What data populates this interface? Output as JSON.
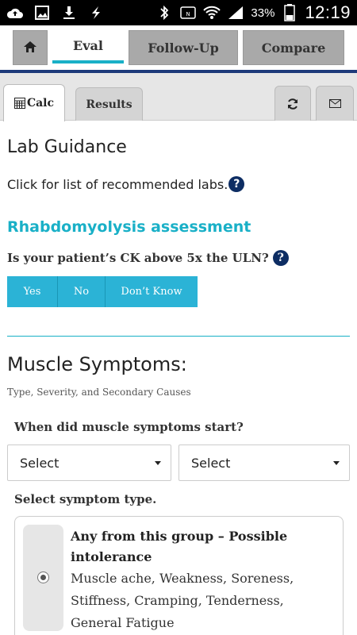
{
  "status_bar": {
    "battery": "33%",
    "time": "12:19",
    "left_icons": [
      "cloud-upload-icon",
      "image-icon",
      "download-icon",
      "lightning-icon"
    ],
    "right_icons": [
      "bluetooth-icon",
      "nfc-icon",
      "wifi-icon",
      "signal-icon",
      "battery-icon"
    ]
  },
  "topnav": {
    "tabs": [
      {
        "label": "Eval",
        "active": true
      },
      {
        "label": "Follow-Up",
        "active": false
      },
      {
        "label": "Compare",
        "active": false
      }
    ]
  },
  "subnav": {
    "calc_label": "Calc",
    "results_label": "Results"
  },
  "lab": {
    "heading": "Lab Guidance",
    "text": "Click for list of recommended labs."
  },
  "rhabdo": {
    "heading": "Rhabdomyolysis assessment",
    "question": "Is your patient’s CK above 5x the ULN?",
    "options": [
      "Yes",
      "No",
      "Don’t Know"
    ]
  },
  "muscle": {
    "heading": "Muscle Symptoms:",
    "subheading": "Type, Severity, and Secondary Causes",
    "start_question": "When did muscle symptoms start?",
    "select_1": "Select",
    "select_2": "Select",
    "type_question": "Select symptom type.",
    "option_title": "Any from this group – Possible intolerance",
    "option_desc": "Muscle ache, Weakness, Soreness, Stiffness, Cramping, Tenderness, General Fatigue"
  },
  "colors": {
    "accent": "#19b0c7",
    "button": "#2bb3d6",
    "navy": "#0d2d63",
    "tab_gray": "#a9a9a9"
  }
}
